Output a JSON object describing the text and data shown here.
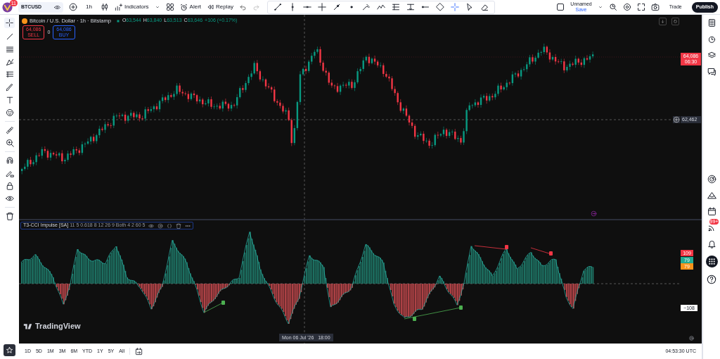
{
  "topbar": {
    "notifications": "11",
    "symbol": "BTCUSD",
    "interval": "1h",
    "indicators": "Indicators",
    "alert": "Alert",
    "replay": "Replay",
    "layout_name": "Unnamed",
    "layout_status": "Save",
    "trade": "Trade",
    "publish": "Publish"
  },
  "legend": {
    "title": "Bitcoin / U.S. Dollar · 1h · Bitstamp",
    "ohlc": [
      {
        "label": "O",
        "value": "63,544"
      },
      {
        "label": "H",
        "value": "63,840"
      },
      {
        "label": "L",
        "value": "63,513"
      },
      {
        "label": "C",
        "value": "63,646"
      }
    ],
    "change": "+106 (+0.17%)"
  },
  "order": {
    "sell_price": "64,086",
    "sell": "SELL",
    "spread": "0",
    "buy_price": "64,086",
    "buy": "BUY"
  },
  "price_labels": [
    {
      "value": "64,086",
      "sub": "06:30",
      "kind": "last"
    },
    {
      "value": "62,462",
      "kind": "crosshair"
    }
  ],
  "indicator": {
    "name": "T3-CCI Impulse [SA]",
    "params": "11 5 0.618 8 12 26 9 Both 4 2 60 5"
  },
  "indicator_labels": [
    {
      "value": "109",
      "color": "#f23645"
    },
    {
      "value": "79",
      "color": "#22ab94"
    },
    {
      "value": "79",
      "color": "#f7931a"
    }
  ],
  "level_label": "−108",
  "chart_logo": "TradingView",
  "crosshair_time": "Mon 06 Jul '26   18:00",
  "ranges": [
    "1D",
    "5D",
    "1M",
    "3M",
    "6M",
    "YTD",
    "1Y",
    "5Y",
    "All"
  ],
  "clock": "04:53:30 UTC",
  "feed_badge": "99+"
}
